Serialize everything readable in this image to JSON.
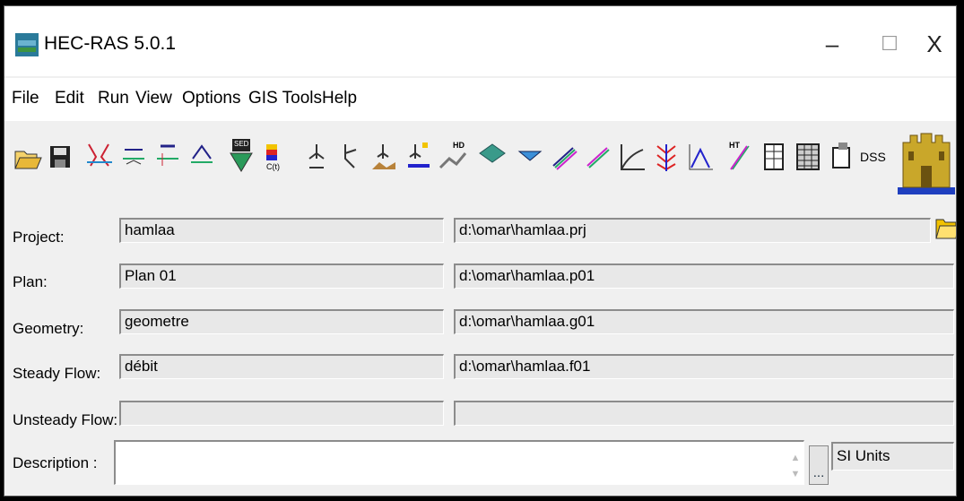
{
  "window": {
    "title": "HEC-RAS 5.0.1",
    "minimize": "–",
    "maximize": "☐",
    "close": "X"
  },
  "menu": [
    "File",
    "Edit",
    "Run",
    "View",
    "Options",
    "GIS Tools",
    "Help"
  ],
  "toolbar": {
    "sed_label": "SED",
    "ct_label": "C(t)",
    "hd_label": "HD",
    "ht_label": "HT",
    "dss_label": "DSS",
    "icons": [
      "open-project-icon",
      "save-project-icon",
      "geometric-data-icon",
      "steady-flow-icon",
      "unsteady-flow-icon",
      "quasi-unsteady-flow-icon",
      "sediment-data-icon",
      "water-quality-data-icon",
      "steady-analysis-icon",
      "unsteady-analysis-icon",
      "sediment-analysis-icon",
      "water-quality-analysis-icon",
      "hydraulic-design-icon",
      "ras-mapper-icon",
      "cross-section-plot-icon",
      "profile-plot-icon",
      "general-profile-plot-icon",
      "rating-curve-icon",
      "xyz-perspective-icon",
      "stage-flow-hydrograph-icon",
      "hydraulic-property-table-icon",
      "detailed-output-table-icon",
      "profile-summary-table-icon",
      "summary-errors-icon",
      "dss-viewer-icon"
    ]
  },
  "rows": [
    {
      "label": "Project:",
      "name": "hamlaa",
      "file": "d:\\omar\\hamlaa.prj"
    },
    {
      "label": "Plan:",
      "name": "Plan 01",
      "file": "d:\\omar\\hamlaa.p01"
    },
    {
      "label": "Geometry:",
      "name": "geometre",
      "file": "d:\\omar\\hamlaa.g01"
    },
    {
      "label": "Steady Flow:",
      "name": "débit",
      "file": "d:\\omar\\hamlaa.f01"
    },
    {
      "label": "Unsteady Flow:",
      "name": "",
      "file": ""
    }
  ],
  "description": {
    "label": "Description :",
    "value": "",
    "more_button": "...",
    "units": "SI Units"
  }
}
